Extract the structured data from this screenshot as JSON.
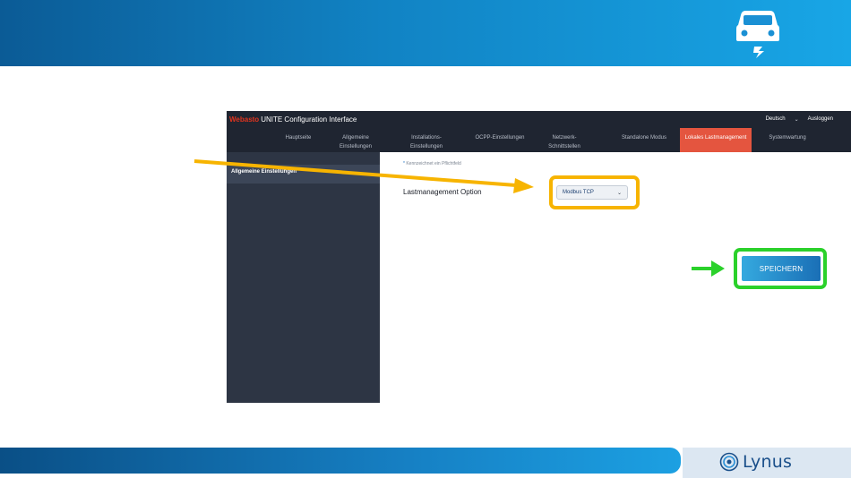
{
  "slide": {
    "icon": "car-charging-icon",
    "logo": {
      "text": "Lynus",
      "icon": "lynus-ring-icon"
    },
    "colors": {
      "highlight_dropdown": "#f7b400",
      "highlight_button": "#2bd12b",
      "banner": "#1183c4"
    }
  },
  "app": {
    "brand_mark": "Webasto",
    "title": "UNITE Configuration Interface",
    "language": "Deutsch",
    "logout": "Ausloggen",
    "tabs": [
      {
        "label": "Hauptseite",
        "active": false
      },
      {
        "label": "Allgemeine Einstellungen",
        "active": false
      },
      {
        "label": "Installations- Einstellungen",
        "active": false
      },
      {
        "label": "OCPP-Einstellungen",
        "active": false
      },
      {
        "label": "Netzwerk- Schnittstellen",
        "active": false
      },
      {
        "label": "Standalone Modus",
        "active": false
      },
      {
        "label": "Lokales Lastmanagement",
        "active": true
      },
      {
        "label": "Systemwartung",
        "active": false
      }
    ],
    "sidebar": {
      "items": [
        {
          "label": "Allgemeine Einstellungen",
          "active": true
        }
      ]
    },
    "content": {
      "required_note": "Kennzeichnet ein Pflichtfeld",
      "field_label": "Lastmanagement Option",
      "select_value": "Modbus TCP",
      "save_label": "SPEICHERN"
    }
  }
}
